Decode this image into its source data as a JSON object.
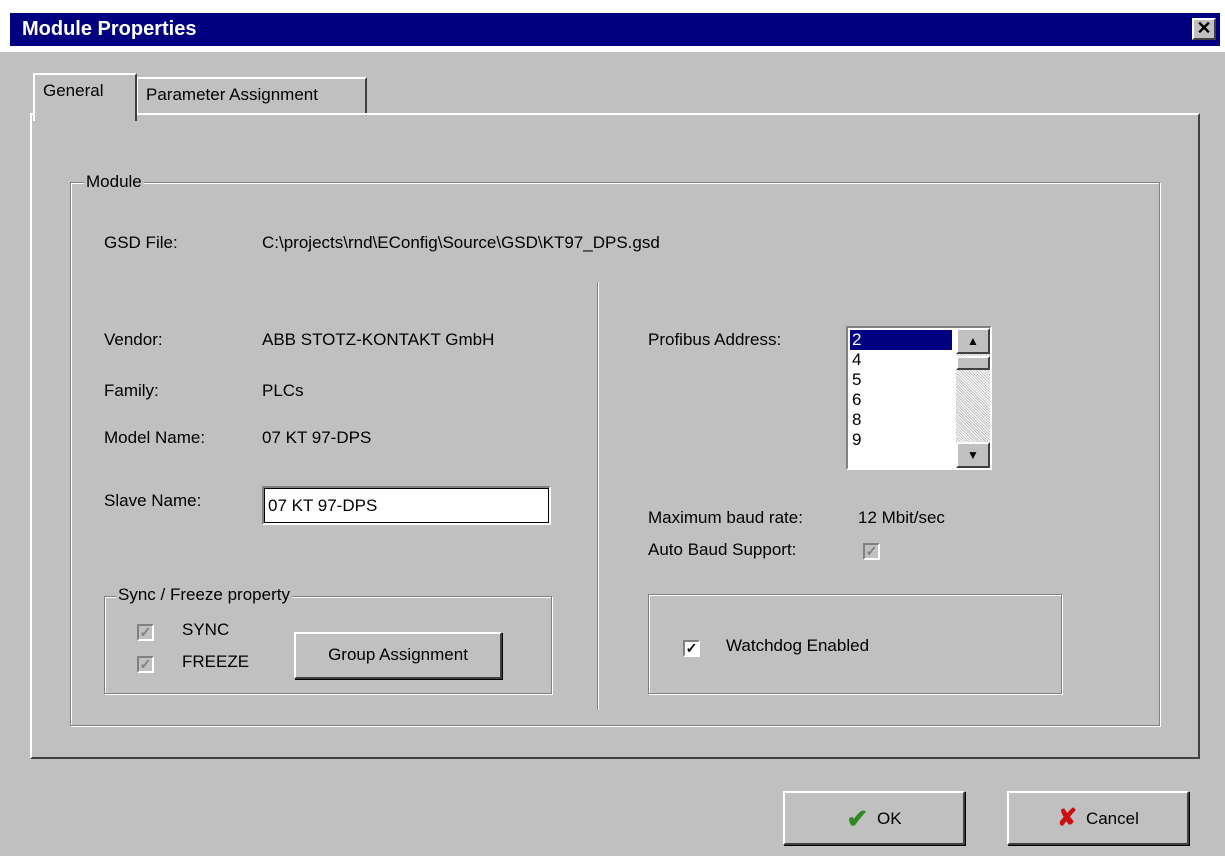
{
  "window": {
    "title": "Module Properties",
    "close_glyph": "✕"
  },
  "tabs": {
    "general": "General",
    "parameter_assignment": "Parameter Assignment"
  },
  "module_group": {
    "legend": "Module",
    "gsd_label": "GSD File:",
    "gsd_value": "C:\\projects\\rnd\\EConfig\\Source\\GSD\\KT97_DPS.gsd",
    "vendor_label": "Vendor:",
    "vendor_value": "ABB STOTZ-KONTAKT GmbH",
    "family_label": "Family:",
    "family_value": "PLCs",
    "model_label": "Model Name:",
    "model_value": "07 KT 97-DPS",
    "slave_label": "Slave Name:",
    "slave_value": "07 KT 97-DPS"
  },
  "sync_freeze": {
    "legend": "Sync / Freeze property",
    "sync_label": "SYNC",
    "sync_checked": true,
    "freeze_label": "FREEZE",
    "freeze_checked": true,
    "group_assignment_button": "Group Assignment"
  },
  "profibus": {
    "address_label": "Profibus Address:",
    "addresses": [
      "2",
      "4",
      "5",
      "6",
      "8",
      "9"
    ],
    "selected": "2",
    "max_baud_label": "Maximum baud rate:",
    "max_baud_value": "12 Mbit/sec",
    "auto_baud_label": "Auto Baud Support:",
    "auto_baud_checked": true
  },
  "watchdog": {
    "label": "Watchdog Enabled",
    "checked": true
  },
  "buttons": {
    "ok": "OK",
    "cancel": "Cancel"
  },
  "colors": {
    "titlebar": "#000080",
    "face": "#c0c0c0",
    "ok_icon": "#2e8b22",
    "cancel_icon": "#cc1010"
  }
}
